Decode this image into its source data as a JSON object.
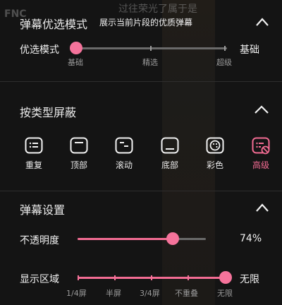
{
  "background": {
    "watermark": "FNC",
    "video_title": "过往荣光了属于是"
  },
  "section_mode": {
    "title": "弹幕优选模式",
    "subtitle": "展示当前片段的优质弹幕",
    "slider": {
      "left_label": "优选模式",
      "right_label": "基础",
      "ticks": [
        "基础",
        "精选",
        "超级"
      ],
      "selected_index": 0
    }
  },
  "section_block": {
    "title": "按类型屏蔽",
    "items": [
      {
        "label": "重复",
        "icon": "repeat-list-icon"
      },
      {
        "label": "顶部",
        "icon": "top-bar-icon"
      },
      {
        "label": "滚动",
        "icon": "scroll-list-icon"
      },
      {
        "label": "底部",
        "icon": "bottom-bar-icon"
      },
      {
        "label": "彩色",
        "icon": "palette-icon"
      },
      {
        "label": "高级",
        "icon": "advanced-block-icon",
        "active": true
      }
    ]
  },
  "section_settings": {
    "title": "弹幕设置",
    "opacity": {
      "label": "不透明度",
      "value": "74%",
      "percent": 74
    },
    "area": {
      "label": "显示区域",
      "value": "无限",
      "ticks": [
        "1/4屏",
        "半屏",
        "3/4屏",
        "不重叠",
        "无限"
      ],
      "selected_index": 4
    }
  },
  "colors": {
    "accent": "#f36c93",
    "background": "#141414",
    "text": "#f2f2f2",
    "muted": "#9a9a9a",
    "track": "#6a6a6a"
  }
}
